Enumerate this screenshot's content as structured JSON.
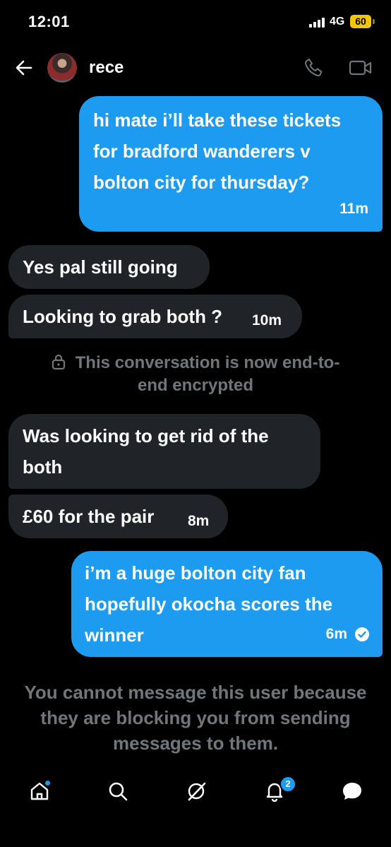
{
  "status_bar": {
    "time": "12:01",
    "network": "4G",
    "battery": "60"
  },
  "header": {
    "contact_name": "rece"
  },
  "messages": [
    {
      "direction": "out",
      "text": "hi mate i’ll take these tickets for bradford wanderers v bolton city for thursday?",
      "time": "11m"
    },
    {
      "direction": "in",
      "text": "Yes pal still going"
    },
    {
      "direction": "in",
      "text": "Looking to grab both ?",
      "time": "10m"
    },
    {
      "direction": "in",
      "text": "Was looking to get rid of the both"
    },
    {
      "direction": "in",
      "text": "£60 for the pair",
      "time": "8m"
    },
    {
      "direction": "out",
      "text": "i’m a huge bolton city fan hopefully okocha scores the winner",
      "time": "6m"
    }
  ],
  "encryption_notice_line1": "This conversation is now end-to-",
  "encryption_notice_line2": "end encrypted",
  "blocked_notice": "You cannot message this user because they are blocking you from sending messages to them.",
  "tabbar": {
    "icons": [
      "home-icon",
      "search-icon",
      "grok-icon",
      "notifications-icon",
      "messages-icon"
    ],
    "notification_count": "2"
  },
  "colors": {
    "accent": "#1d9bf0",
    "incoming_bubble": "#202327",
    "muted_text": "#71767b",
    "battery": "#f4c60b"
  }
}
